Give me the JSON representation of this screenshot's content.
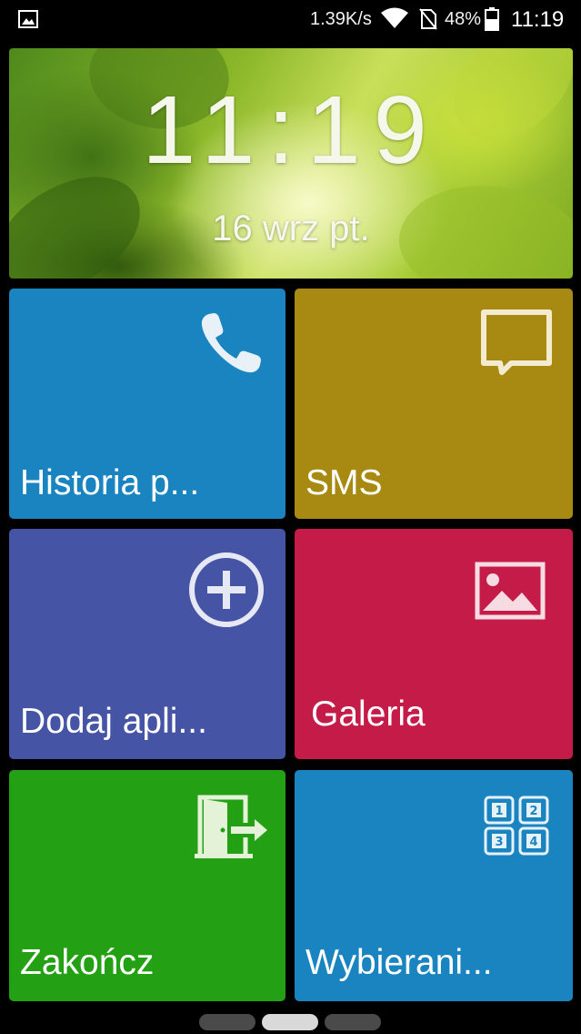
{
  "status_bar": {
    "network_speed": "1.39K/s",
    "battery_percent": "48%",
    "time": "11:19",
    "icons": [
      "image-notification-icon",
      "wifi-icon",
      "no-sim-icon",
      "battery-icon"
    ]
  },
  "clock_widget": {
    "time": "11:19",
    "date": "16 wrz  pt."
  },
  "tiles": [
    {
      "label": "Historia p...",
      "icon": "phone-icon",
      "color": "#1a84c0"
    },
    {
      "label": "SMS",
      "icon": "message-icon",
      "color": "#a88a12"
    },
    {
      "label": "Dodaj apli...",
      "icon": "add-circle-icon",
      "color": "#4554a4"
    },
    {
      "label": "Galeria",
      "icon": "picture-icon",
      "color": "#c41b48"
    },
    {
      "label": "Zakończ",
      "icon": "exit-door-icon",
      "color": "#24a014"
    },
    {
      "label": "Wybierani...",
      "icon": "dialpad-icon",
      "color": "#1a84c0"
    }
  ],
  "page_indicator": {
    "pages": 3,
    "current": 2
  }
}
